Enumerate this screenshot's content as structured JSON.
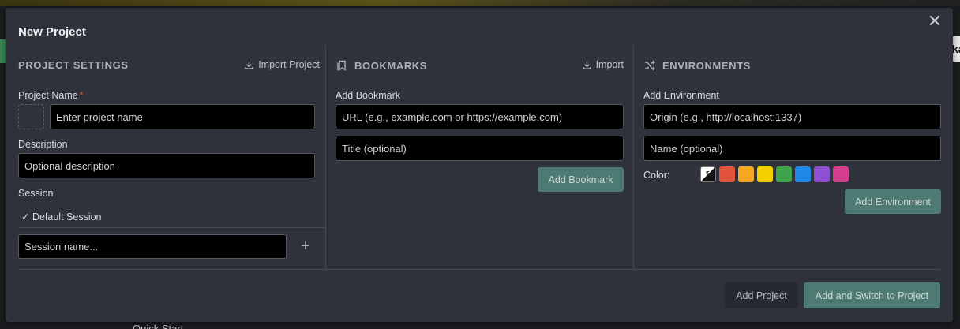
{
  "modal": {
    "title": "New Project",
    "close_glyph": "✕"
  },
  "project_settings": {
    "title": "PROJECT SETTINGS",
    "import_label": "Import Project",
    "name_label": "Project Name",
    "required_mark": "*",
    "name_placeholder": "Enter project name",
    "description_label": "Description",
    "description_placeholder": "Optional description",
    "session_label": "Session",
    "session_item": "✓ Default Session",
    "session_placeholder": "Session name...",
    "add_session_glyph": "+"
  },
  "bookmarks": {
    "title": "BOOKMARKS",
    "import_label": "Import",
    "add_label": "Add Bookmark",
    "url_placeholder": "URL (e.g., example.com or https://example.com)",
    "title_placeholder": "Title (optional)",
    "add_button": "Add Bookmark"
  },
  "environments": {
    "title": "ENVIRONMENTS",
    "add_label": "Add Environment",
    "origin_placeholder": "Origin (e.g., http://localhost:1337)",
    "name_placeholder": "Name (optional)",
    "color_label": "Color:",
    "swatches": [
      "default",
      "#e5533d",
      "#f5a623",
      "#f5d000",
      "#3fa34d",
      "#1e88e5",
      "#8e4fd1",
      "#d63d8f"
    ],
    "add_button": "Add Environment"
  },
  "footer": {
    "add_project": "Add Project",
    "add_and_switch": "Add and Switch to Project"
  },
  "background": {
    "bottom_text": "Quick Start",
    "right_edge_text": "ka"
  },
  "colors": {
    "modal_bg": "#2f323a",
    "accent_teal": "#4d7b74",
    "required": "#e05252"
  }
}
